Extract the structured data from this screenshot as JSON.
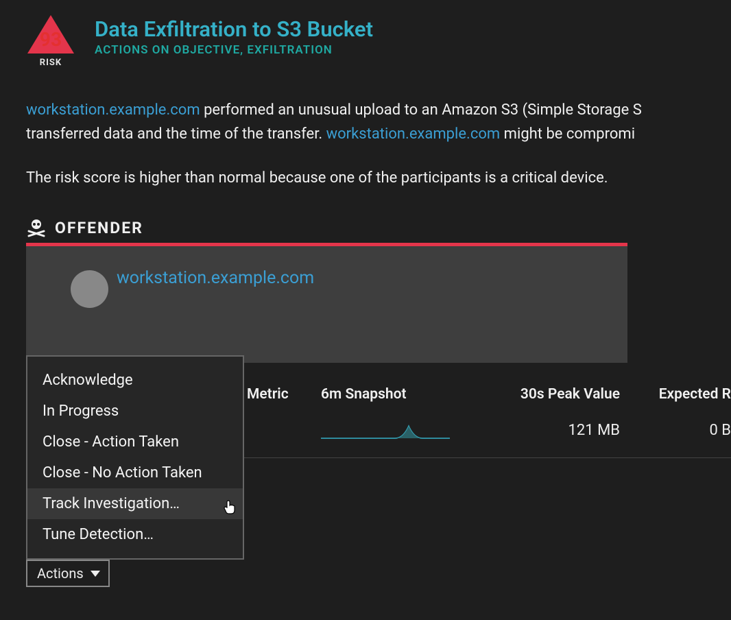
{
  "risk": {
    "score": "93",
    "label": "RISK"
  },
  "title": "Data Exfiltration to S3 Bucket",
  "categories": "ACTIONS ON OBJECTIVE, EXFILTRATION",
  "desc": {
    "host1": "workstation.example.com",
    "text1": " performed an unusual upload to an Amazon S3 (Simple Storage S",
    "text2": "transferred data and the time of the transfer. ",
    "host2": "workstation.example.com",
    "text3": " might be compromi"
  },
  "risk_note": "The risk score is higher than normal because one of the participants is a critical device.",
  "section_title": "OFFENDER",
  "offender_host": "workstation.example.com",
  "table": {
    "headers": {
      "metric": "Metric",
      "snapshot": "6m Snapshot",
      "peak": "30s Peak Value",
      "expected": "Expected R"
    },
    "row": {
      "peak": "121 MB",
      "expected": "0 B"
    }
  },
  "actions_button": "Actions",
  "menu": [
    "Acknowledge",
    "In Progress",
    "Close - Action Taken",
    "Close - No Action Taken",
    "Track Investigation…",
    "Tune Detection…"
  ]
}
